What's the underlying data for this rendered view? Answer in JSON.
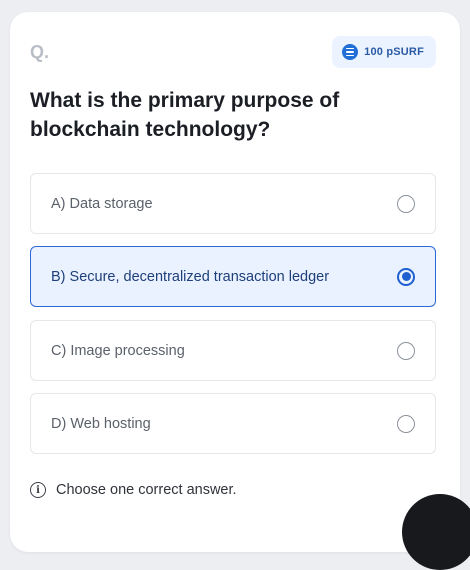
{
  "question_card": {
    "label": "Q.",
    "reward": {
      "amount_text": "100 pSURF",
      "icon": "coin-icon"
    },
    "question": "What is the primary purpose of blockchain technology?",
    "options": [
      {
        "label": "A) Data storage",
        "selected": false
      },
      {
        "label": "B) Secure, decentralized transaction ledger",
        "selected": true
      },
      {
        "label": "C) Image processing",
        "selected": false
      },
      {
        "label": "D) Web hosting",
        "selected": false
      }
    ],
    "hint": {
      "icon": "info-icon",
      "text": "Choose one correct answer."
    }
  },
  "colors": {
    "accent": "#1f5fd0",
    "selected_bg": "#eaf2ff",
    "reward_bg": "#eaf3ff"
  }
}
